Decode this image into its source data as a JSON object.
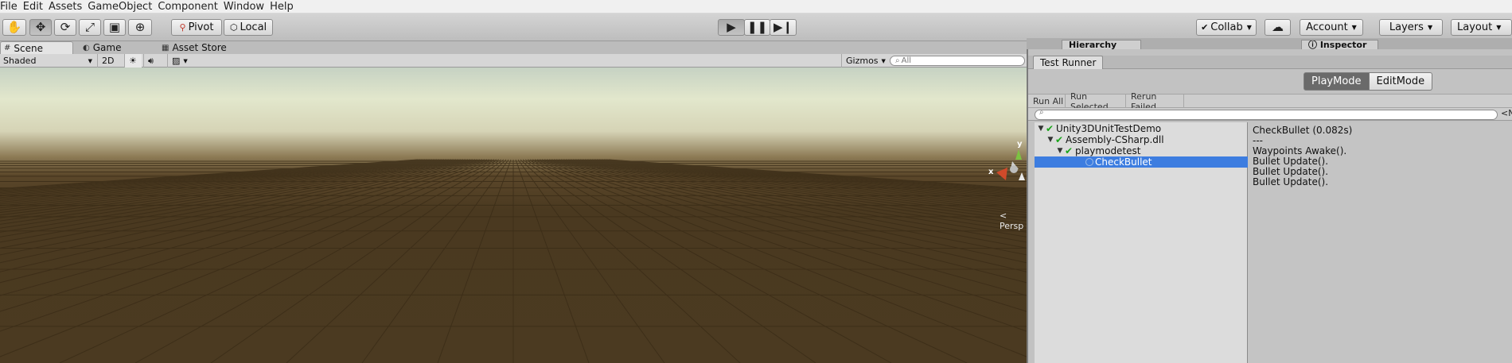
{
  "menu": [
    "File",
    "Edit",
    "Assets",
    "GameObject",
    "Component",
    "Window",
    "Help"
  ],
  "toolbar": {
    "tools": [
      "hand-tool",
      "move-tool",
      "rotate-tool",
      "scale-tool",
      "rect-tool",
      "transform-tool"
    ],
    "pivot_label": "Pivot",
    "local_label": "Local",
    "collab_label": "Collab",
    "account_label": "Account",
    "layers_label": "Layers",
    "layout_label": "Layout"
  },
  "scene_tabs": [
    {
      "label": "Scene",
      "icon": "hash-icon",
      "active": true
    },
    {
      "label": "Game",
      "icon": "pacman-icon",
      "active": false
    },
    {
      "label": "Asset Store",
      "icon": "store-icon",
      "active": false
    }
  ],
  "scene_toolbar": {
    "shading_mode": "Shaded",
    "mode_2d": "2D",
    "gizmos_label": "Gizmos",
    "search_placeholder": "All"
  },
  "gizmo": {
    "y_label": "y",
    "x_label": "x",
    "persp_label": "< Persp"
  },
  "background_tabs": {
    "hierarchy": "Hierarchy",
    "inspector": "Inspector"
  },
  "test_runner": {
    "tab_title": "Test Runner",
    "modes": {
      "play": "PlayMode",
      "edit": "EditMode"
    },
    "actions": {
      "run_all": "Run All",
      "run_selected": "Run Selected",
      "rerun_failed": "Rerun Failed"
    },
    "collapse_label": "<N",
    "tree": [
      {
        "label": "Unity3DUnitTestDemo",
        "depth": 0,
        "status": "passed",
        "expanded": true,
        "selected": false
      },
      {
        "label": "Assembly-CSharp.dll",
        "depth": 1,
        "status": "passed",
        "expanded": true,
        "selected": false
      },
      {
        "label": "playmodetest",
        "depth": 2,
        "status": "passed",
        "expanded": true,
        "selected": false
      },
      {
        "label": "CheckBullet",
        "depth": 3,
        "status": "running",
        "expanded": false,
        "selected": true
      }
    ],
    "log": [
      "CheckBullet (0.082s)",
      "---",
      "Waypoints Awake().",
      "Bullet Update().",
      "Bullet Update().",
      "Bullet Update()."
    ]
  },
  "colors": {
    "selection": "#3d7de0",
    "pass_check": "#1aa51a",
    "ground": "#4b3a21",
    "sky": "#e2e7cc"
  }
}
